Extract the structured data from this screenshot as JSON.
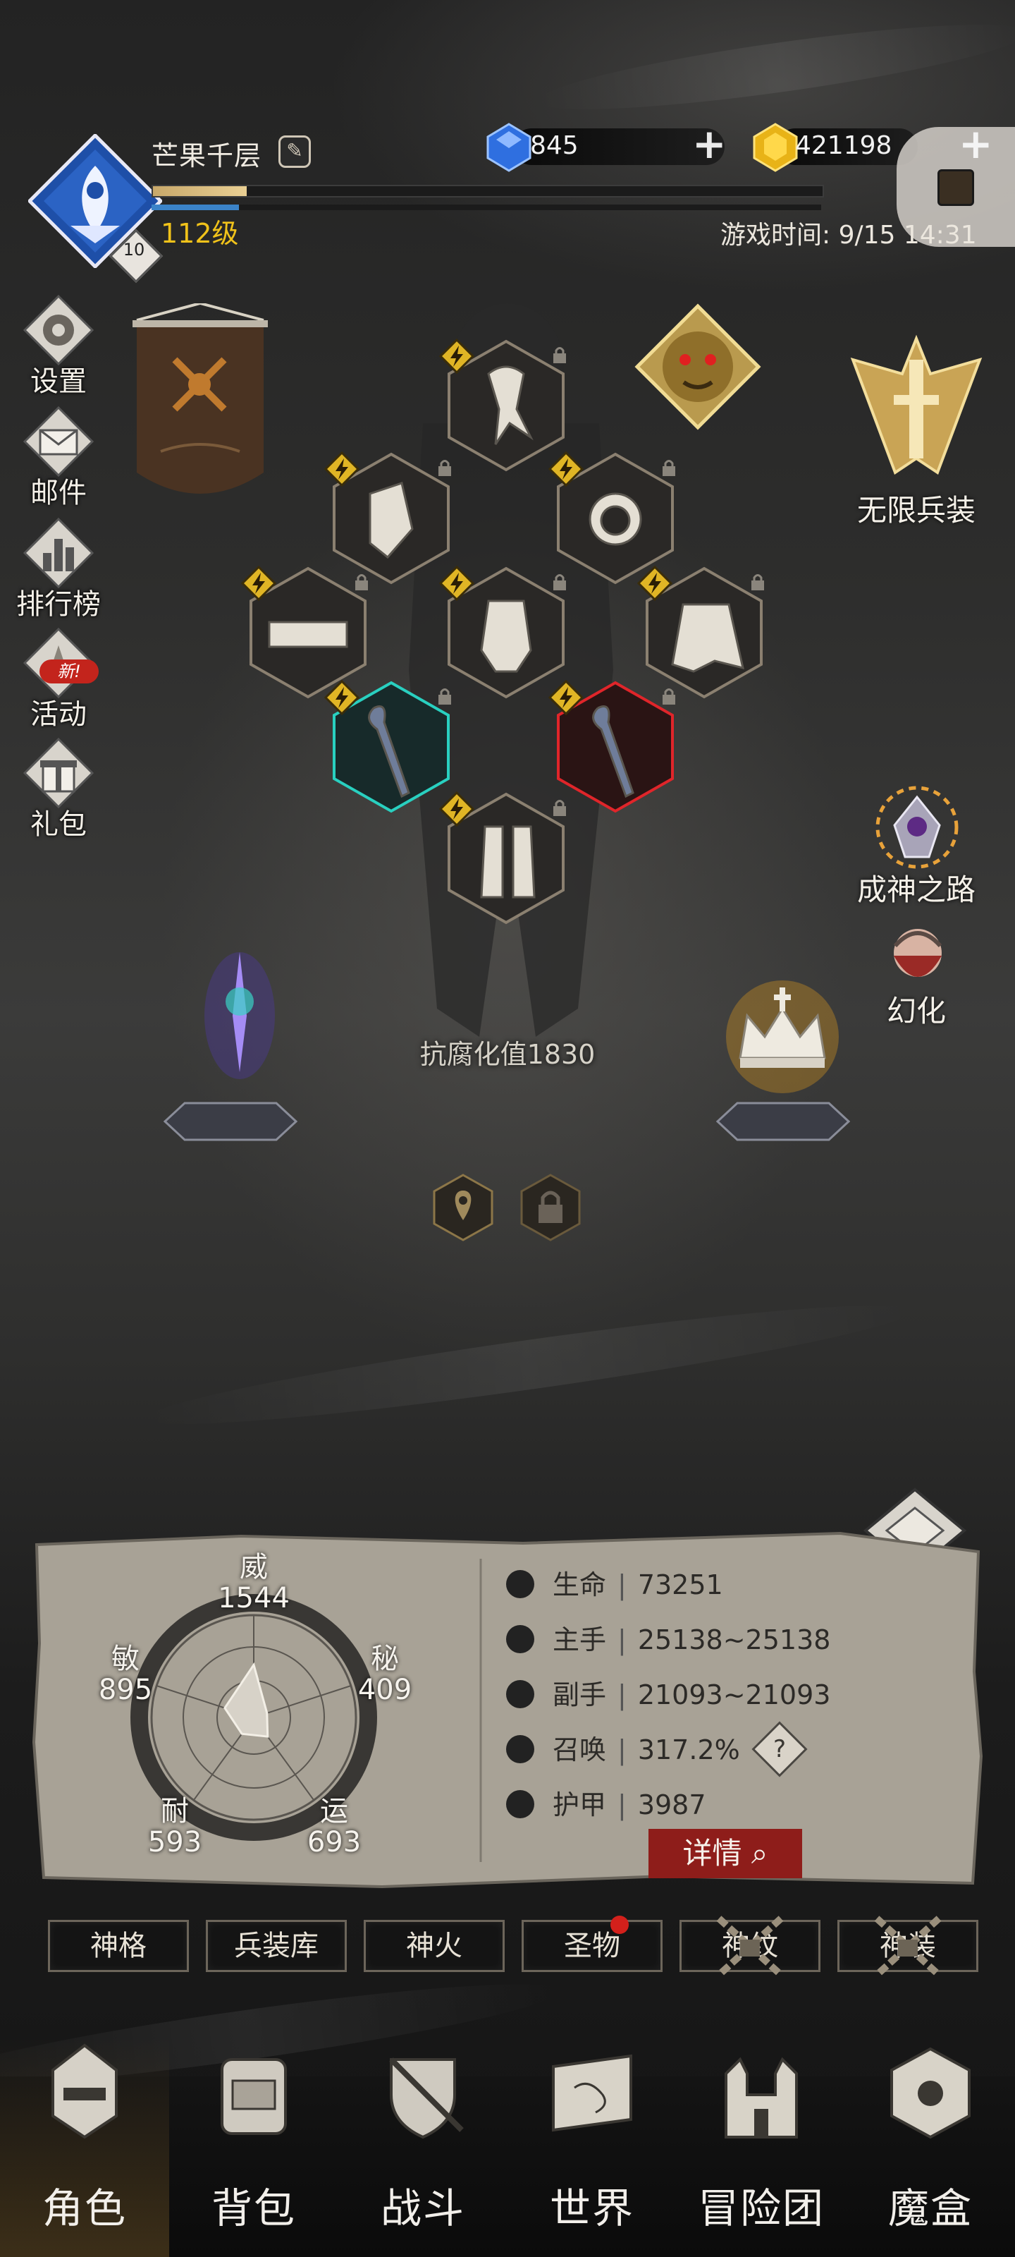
{
  "header": {
    "player_name": "芒果千层",
    "level_label": "112级",
    "level_badge": "10",
    "xp_progress": 0.14,
    "mp_progress": 0.13,
    "game_time": "游戏时间: 9/15 14:31"
  },
  "resources": {
    "diamonds": "845",
    "gold": "421198"
  },
  "side_menu": [
    {
      "label": "设置",
      "icon": "gear-icon"
    },
    {
      "label": "邮件",
      "icon": "mail-icon"
    },
    {
      "label": "排行榜",
      "icon": "ranking-icon"
    },
    {
      "label": "活动",
      "icon": "event-icon"
    },
    {
      "label": "礼包",
      "icon": "gift-icon"
    }
  ],
  "new_tag": "新!",
  "right_menu": {
    "infinite_gear": "无限兵装",
    "path_to_godhood": "成神之路",
    "transform": "幻化"
  },
  "equipment": {
    "slots": [
      "scarf-icon",
      "gauntlet-icon",
      "ring-icon",
      "belt-icon",
      "armor-icon",
      "skirt-icon",
      "staff-icon",
      "staff-icon",
      "boots-icon"
    ],
    "corruption_resistance": "抗腐化值1830"
  },
  "stats": {
    "radar": {
      "wei": {
        "label": "威",
        "value": "1544"
      },
      "mi": {
        "label": "秘",
        "value": "409"
      },
      "yun": {
        "label": "运",
        "value": "693"
      },
      "nai": {
        "label": "耐",
        "value": "593"
      },
      "min": {
        "label": "敏",
        "value": "895"
      }
    },
    "lines": [
      {
        "name": "生命",
        "value": "73251",
        "icon": "heart-icon"
      },
      {
        "name": "主手",
        "value": "25138~25138",
        "icon": "sword-icon"
      },
      {
        "name": "副手",
        "value": "21093~21093",
        "icon": "offhand-icon"
      },
      {
        "name": "召唤",
        "value": "317.2%",
        "icon": "summon-icon"
      },
      {
        "name": "护甲",
        "value": "3987",
        "icon": "armor-icon"
      }
    ],
    "detail_button": "详情",
    "help": "?"
  },
  "tabs": [
    {
      "label": "神格",
      "locked": false
    },
    {
      "label": "兵装库",
      "locked": false
    },
    {
      "label": "神火",
      "locked": false
    },
    {
      "label": "圣物",
      "locked": false
    },
    {
      "label": "神纹",
      "locked": true
    },
    {
      "label": "神装",
      "locked": true
    }
  ],
  "bottom_nav": [
    {
      "label": "角色",
      "icon": "helmet-icon",
      "active": true
    },
    {
      "label": "背包",
      "icon": "backpack-icon",
      "active": false
    },
    {
      "label": "战斗",
      "icon": "shield-icon",
      "active": false
    },
    {
      "label": "世界",
      "icon": "map-scroll-icon",
      "active": false
    },
    {
      "label": "冒险团",
      "icon": "castle-icon",
      "active": false
    },
    {
      "label": "魔盒",
      "icon": "magic-box-icon",
      "active": false
    }
  ],
  "colors": {
    "accent_gold": "#f0c21a",
    "detail_red": "#8e1d1a",
    "notification_red": "#d3201b"
  }
}
